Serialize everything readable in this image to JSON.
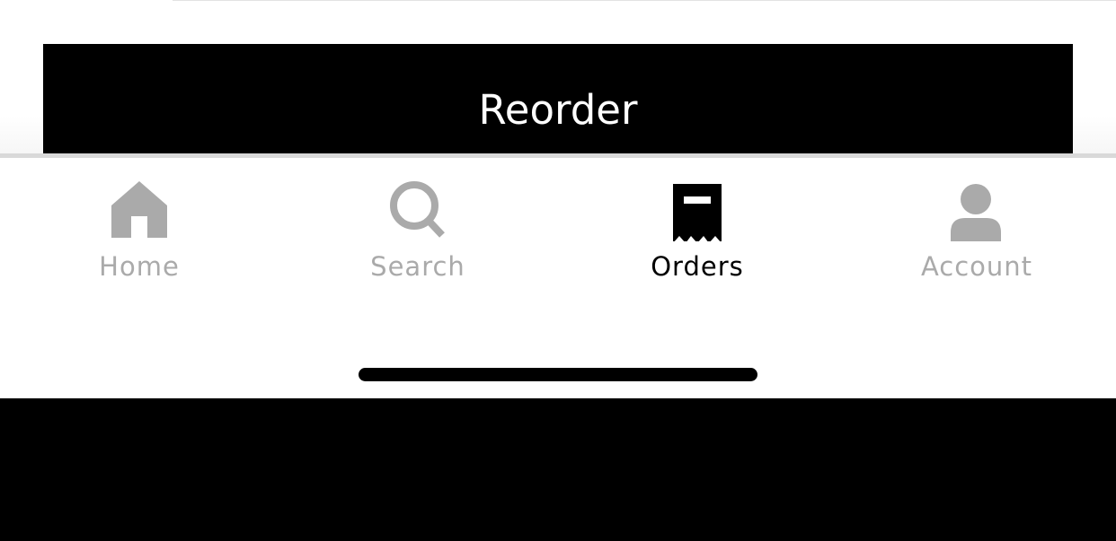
{
  "colors": {
    "active": "#000000",
    "inactive": "#aaaaaa",
    "background": "#ffffff"
  },
  "reorder": {
    "label": "Reorder"
  },
  "tabbar": {
    "tabs": [
      {
        "label": "Home",
        "icon": "home-icon",
        "active": false
      },
      {
        "label": "Search",
        "icon": "search-icon",
        "active": false
      },
      {
        "label": "Orders",
        "icon": "receipt-icon",
        "active": true
      },
      {
        "label": "Account",
        "icon": "person-icon",
        "active": false
      }
    ]
  }
}
